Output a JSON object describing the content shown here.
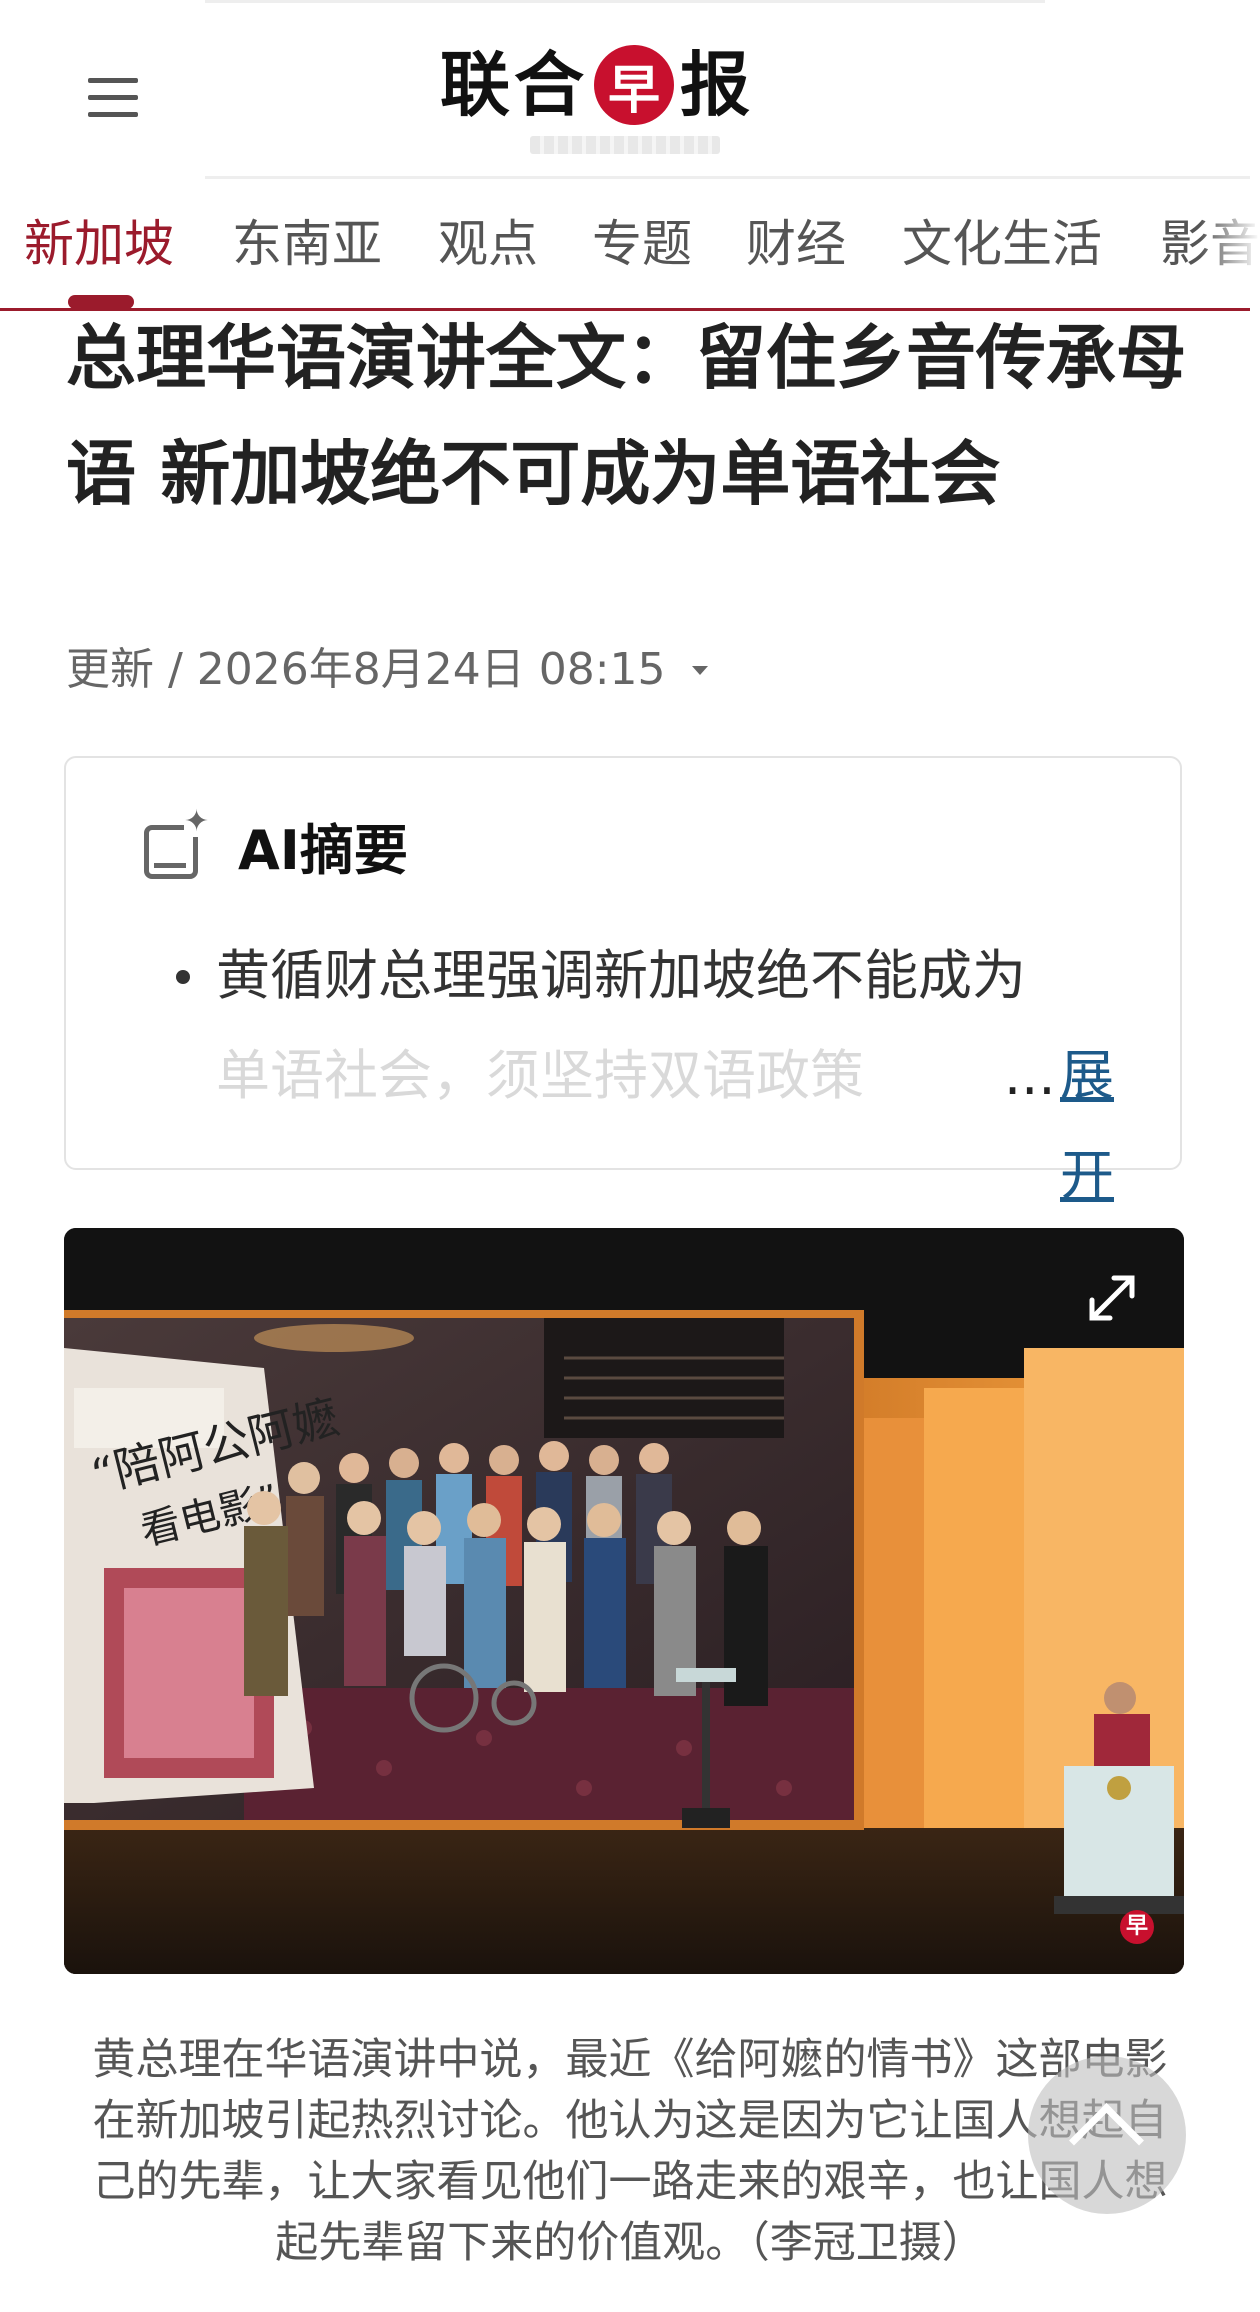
{
  "header": {
    "logo_text_1": "联合",
    "logo_badge": "早",
    "logo_text_2": "报"
  },
  "nav": {
    "items": [
      {
        "label": "新加坡",
        "active": true
      },
      {
        "label": "东南亚"
      },
      {
        "label": "观点"
      },
      {
        "label": "专题"
      },
      {
        "label": "财经"
      },
      {
        "label": "文化生活"
      },
      {
        "label": "影音"
      }
    ]
  },
  "article": {
    "title": "总理华语演讲全文：留住乡音传承母语 新加坡绝不可成为单语社会",
    "meta": "更新 / 2026年8月24日 08:15"
  },
  "ai_summary": {
    "label": "AI摘要",
    "line1": "黄循财总理强调新加坡绝不能成为",
    "line2": "单语社会，须坚持双语政策",
    "ellipsis": "...",
    "expand_label": "展开"
  },
  "photo": {
    "badge": "早"
  },
  "caption": "黄总理在华语演讲中说，最近《给阿嬷的情书》这部电影在新加坡引起热烈讨论。他认为这是因为它让国人想起自己的先辈，让大家看见他们一路走来的艰辛，也让国人想起先辈留下来的价值观。（李冠卫摄）",
  "colors": {
    "accent": "#9b1b2c",
    "brand_red": "#c8102e",
    "link": "#1d5a8a"
  }
}
